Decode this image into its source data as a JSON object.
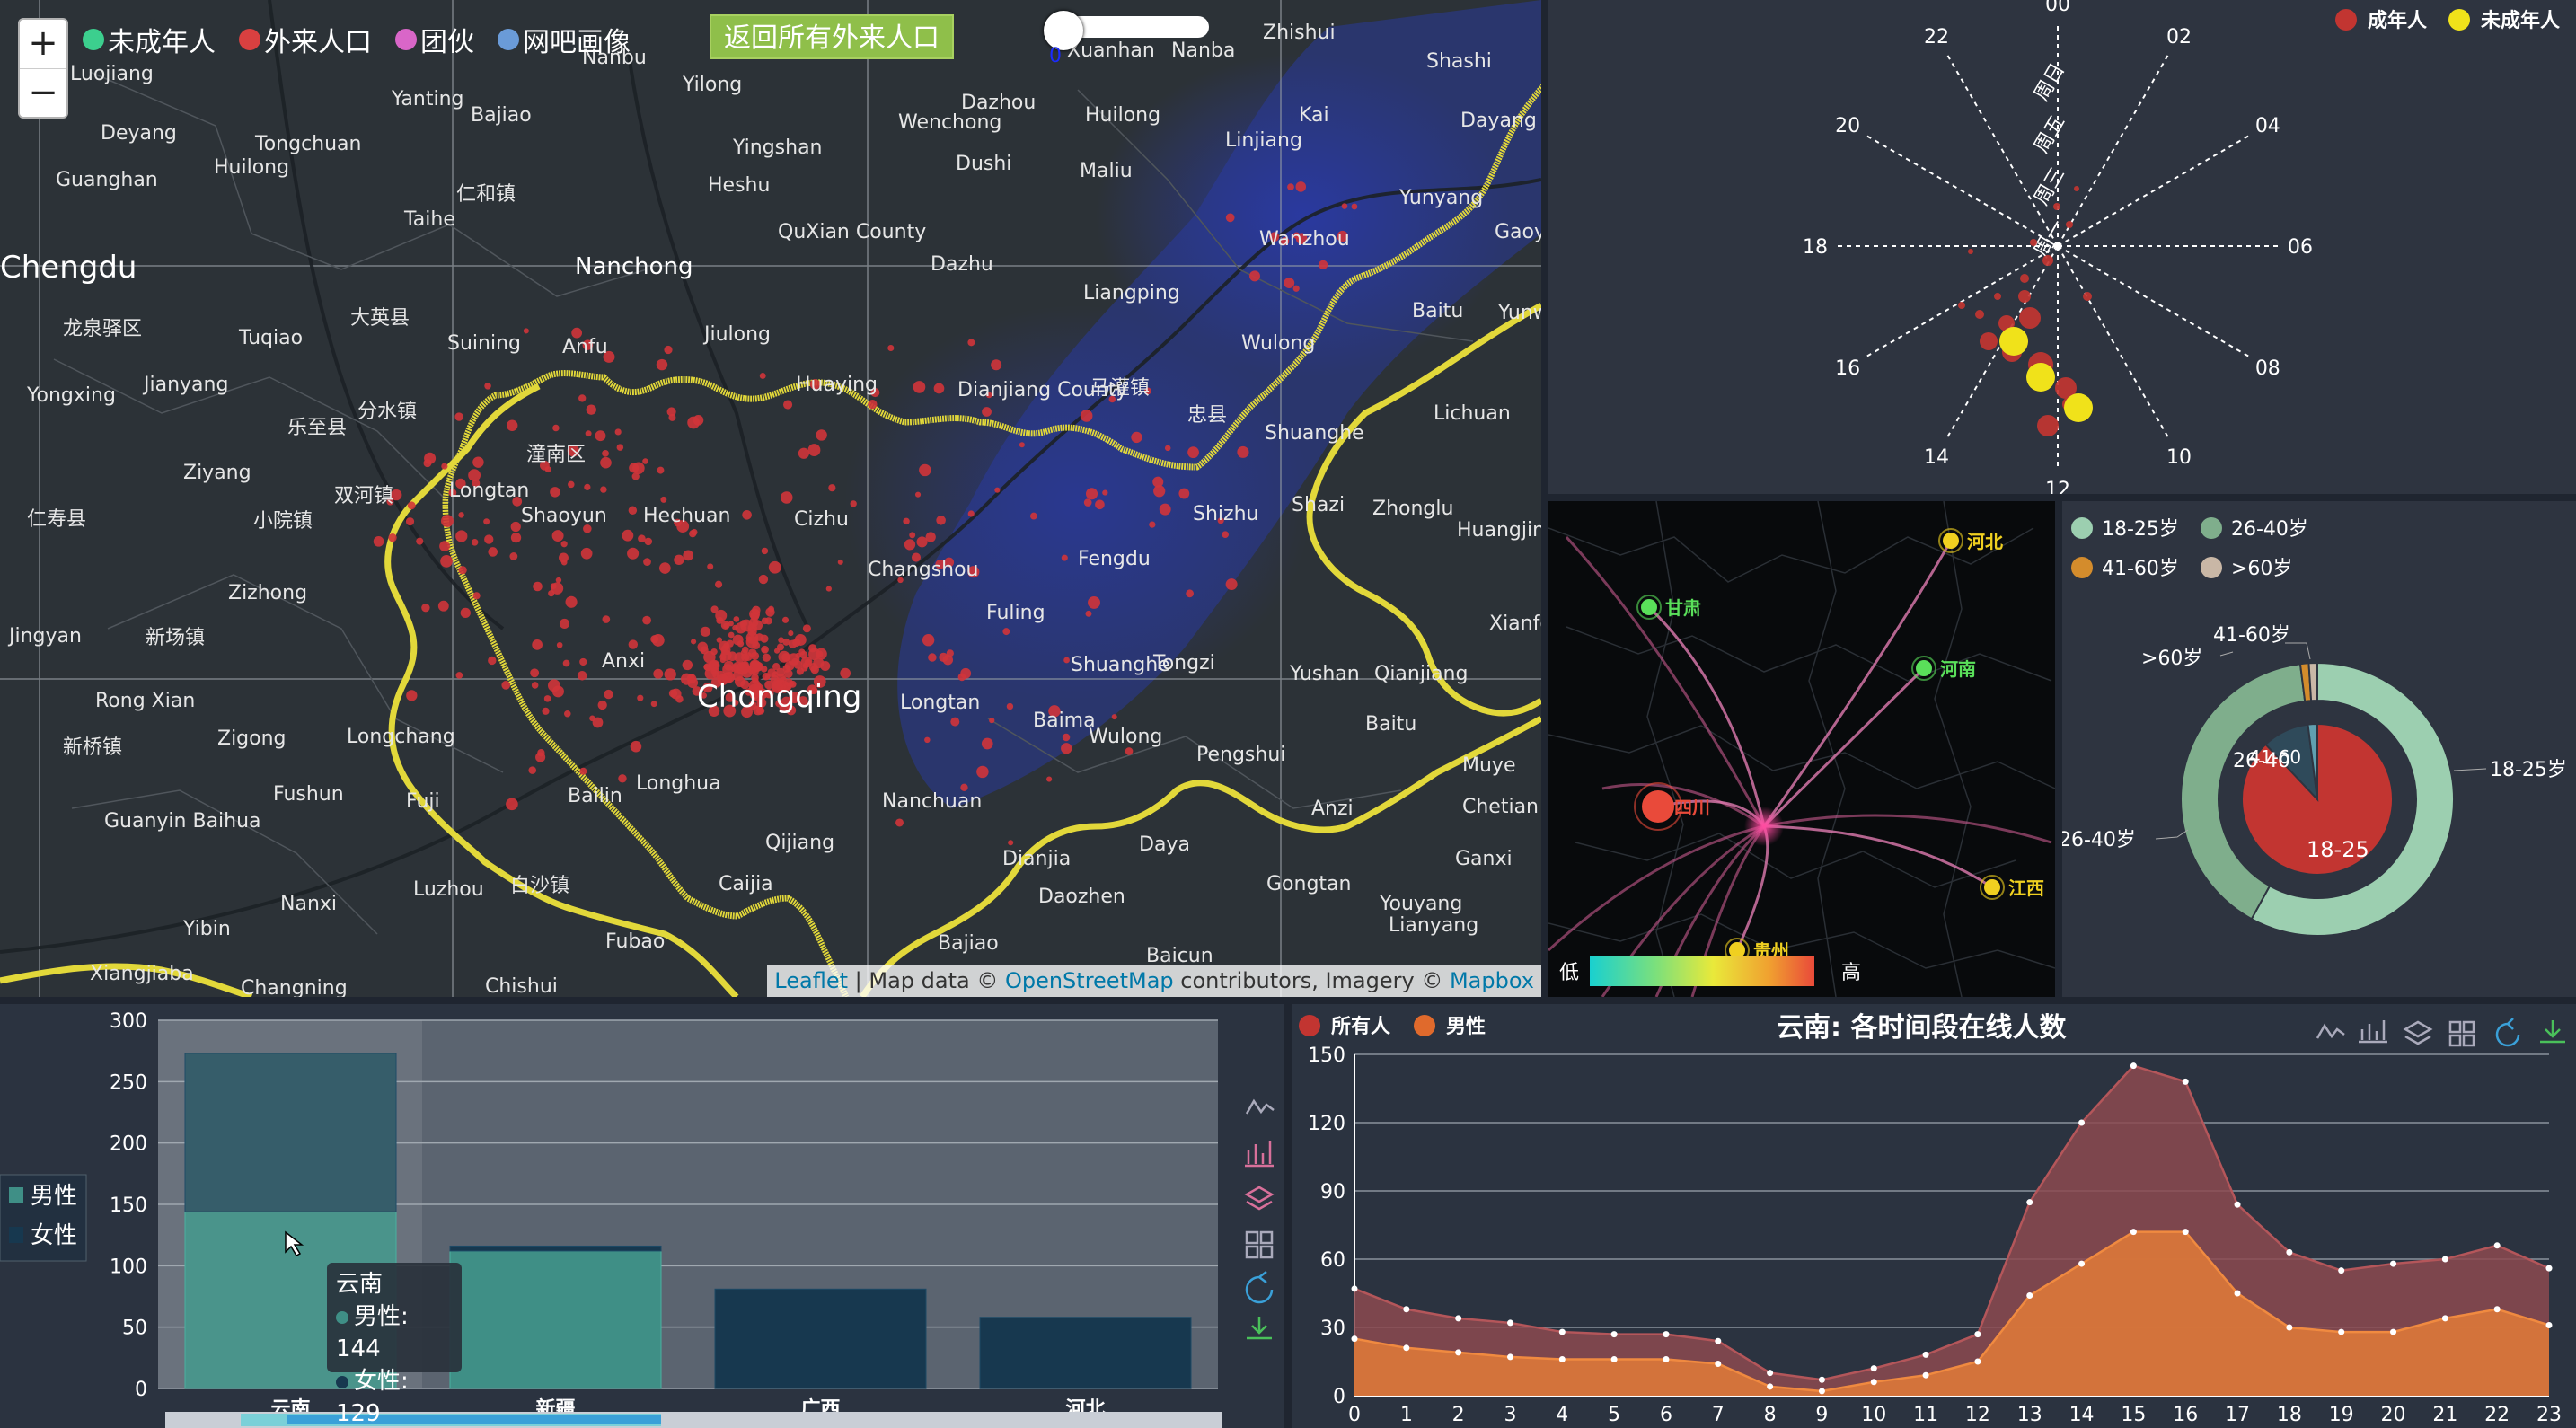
{
  "map": {
    "zoom_in": "+",
    "zoom_out": "−",
    "layers": [
      {
        "label": "未成年人",
        "color": "#3ccf8e"
      },
      {
        "label": "外来人口",
        "color": "#d94040"
      },
      {
        "label": "团伙",
        "color": "#d966c8"
      },
      {
        "label": "网吧画像",
        "color": "#6a9bd8"
      }
    ],
    "back_button": "返回所有外来人口",
    "slider_value": "0",
    "attribution": {
      "leaflet": "Leaflet",
      "sep1": " | Map data © ",
      "osm": "OpenStreetMap",
      "sep2": " contributors, Imagery © ",
      "mapbox": "Mapbox"
    },
    "place_labels": [
      {
        "text": "Luojiang"
      },
      {
        "text": "Nanbu"
      },
      {
        "text": "Yilong"
      },
      {
        "text": "Dazhou"
      },
      {
        "text": "Xuanhan"
      },
      {
        "text": "Deyang"
      },
      {
        "text": "Tongchuan"
      },
      {
        "text": "Yingshan"
      },
      {
        "text": "Wenchong"
      },
      {
        "text": "Huilong"
      },
      {
        "text": "Guanghan"
      },
      {
        "text": "Huilong"
      },
      {
        "text": "Heshu"
      },
      {
        "text": "Dushi"
      },
      {
        "text": "Maliu"
      },
      {
        "text": "Kai"
      },
      {
        "text": "Linjiang"
      },
      {
        "text": "Shashi"
      },
      {
        "text": "Dayang"
      },
      {
        "text": "Yunyang"
      },
      {
        "text": "Chengdu"
      },
      {
        "text": "Nanchong"
      },
      {
        "text": "QuXian County"
      },
      {
        "text": "Dazhu"
      },
      {
        "text": "Liangping"
      },
      {
        "text": "Wanzhou"
      },
      {
        "text": "大英县"
      },
      {
        "text": "Suining"
      },
      {
        "text": "Anfu"
      },
      {
        "text": "Jiulong"
      },
      {
        "text": "Huaying"
      },
      {
        "text": "Dianjiang County"
      },
      {
        "text": "马灌镇"
      },
      {
        "text": "忠县"
      },
      {
        "text": "Wulong"
      },
      {
        "text": "Baitu"
      },
      {
        "text": "Lichuan"
      },
      {
        "text": "龙泉驿区"
      },
      {
        "text": "Tuqiao"
      },
      {
        "text": "Jianyang"
      },
      {
        "text": "乐至县"
      },
      {
        "text": "分水镇"
      },
      {
        "text": "潼南区"
      },
      {
        "text": "Shuanghe"
      },
      {
        "text": "Ziyang"
      },
      {
        "text": "双河镇"
      },
      {
        "text": "Longtan"
      },
      {
        "text": "Shaoyun"
      },
      {
        "text": "Hechuan"
      },
      {
        "text": "Cizhu"
      },
      {
        "text": "Changshou"
      },
      {
        "text": "Fengdu"
      },
      {
        "text": "Shizhu"
      },
      {
        "text": "Shazi"
      },
      {
        "text": "Zhonglu"
      },
      {
        "text": "Huangjindong"
      },
      {
        "text": "仁寿县"
      },
      {
        "text": "小院镇"
      },
      {
        "text": "Zizhong"
      },
      {
        "text": "Fuling"
      },
      {
        "text": "Jingyan"
      },
      {
        "text": "新场镇"
      },
      {
        "text": "Shuanghe"
      },
      {
        "text": "Tongzi"
      },
      {
        "text": "Chongqing"
      },
      {
        "text": "Yushan"
      },
      {
        "text": "Qianjiang"
      },
      {
        "text": "Xianfeng"
      },
      {
        "text": "Rong Xian"
      },
      {
        "text": "Zigong"
      },
      {
        "text": "Longchang"
      },
      {
        "text": "Anxi"
      },
      {
        "text": "Longtan"
      },
      {
        "text": "Baima"
      },
      {
        "text": "Wulong"
      },
      {
        "text": "Pengshui"
      },
      {
        "text": "Baitu"
      },
      {
        "text": "Muye"
      },
      {
        "text": "新桥镇"
      },
      {
        "text": "Fushun"
      },
      {
        "text": "Fuji"
      },
      {
        "text": "Bailin"
      },
      {
        "text": "Longhua"
      },
      {
        "text": "Nanchuan"
      },
      {
        "text": "Chetian"
      },
      {
        "text": "Anzi"
      },
      {
        "text": "Guanyin Baihua"
      },
      {
        "text": "Luzhou"
      },
      {
        "text": "Qijiang"
      },
      {
        "text": "Daya"
      },
      {
        "text": "Ganxi"
      },
      {
        "text": "Nanxi"
      },
      {
        "text": "白沙镇"
      },
      {
        "text": "Caijia"
      },
      {
        "text": "Dianjia"
      },
      {
        "text": "Daozhen"
      },
      {
        "text": "Gongtan"
      },
      {
        "text": "Youyang"
      },
      {
        "text": "Yibin"
      },
      {
        "text": "Fubao"
      },
      {
        "text": "Xiangjiaba"
      },
      {
        "text": "Changning"
      },
      {
        "text": "Chishui"
      },
      {
        "text": "Bajiao"
      },
      {
        "text": "Baicun"
      },
      {
        "text": "Yanting"
      },
      {
        "text": "Bajiao"
      },
      {
        "text": "仁和镇"
      },
      {
        "text": "Taihe"
      },
      {
        "text": "Yongxing"
      },
      {
        "text": "Zhishui"
      },
      {
        "text": "Nanba"
      },
      {
        "text": "Gaoy"
      },
      {
        "text": "Yunw"
      },
      {
        "text": "Lianyang"
      }
    ]
  },
  "radial": {
    "legend": [
      {
        "label": "成年人",
        "color": "#c23531"
      },
      {
        "label": "未成年人",
        "color": "#f0e21a"
      }
    ],
    "hours": [
      "00",
      "02",
      "04",
      "06",
      "08",
      "10",
      "12",
      "14",
      "16",
      "18",
      "20",
      "22"
    ],
    "days": [
      "周日",
      "周五",
      "周三",
      "周一"
    ]
  },
  "migration": {
    "provinces": [
      "河北",
      "甘肃",
      "河南",
      "四川",
      "江西",
      "贵州"
    ],
    "scale_low": "低",
    "scale_high": "高"
  },
  "donut": {
    "legend": [
      {
        "label": "18-25岁",
        "color": "#9ccfb0"
      },
      {
        "label": "26-40岁",
        "color": "#7fae8c"
      },
      {
        "label": "41-60岁",
        "color": "#d48c2c"
      },
      {
        "label": ">60岁",
        "color": "#c9b7a6"
      }
    ],
    "outer_labels": [
      ">60岁",
      "41-60岁",
      "18-25岁",
      "26-40岁"
    ],
    "inner_labels": [
      "18-25",
      "26-40",
      "41-60"
    ]
  },
  "bar": {
    "legend": [
      {
        "label": "男性",
        "color": "#3f8f86"
      },
      {
        "label": "女性",
        "color": "#17384f"
      }
    ],
    "tooltip": {
      "title": "云南",
      "male": "男性: 144",
      "female": "女性: 129"
    },
    "toolbox": [
      "line-chart-icon",
      "bar-chart-icon",
      "stack-icon",
      "tiled-icon",
      "restore-icon",
      "download-icon"
    ]
  },
  "line": {
    "title": "云南: 各时间段在线人数",
    "legend": [
      {
        "label": "所有人",
        "color": "#c23531"
      },
      {
        "label": "男性",
        "color": "#e06a2c"
      }
    ],
    "toolbox": [
      "line-chart-icon",
      "bar-chart-icon",
      "stack-icon",
      "tiled-icon",
      "restore-icon",
      "download-icon"
    ]
  },
  "chart_data": [
    {
      "type": "bar",
      "categories": [
        "云南",
        "新疆",
        "广西",
        "河北"
      ],
      "series": [
        {
          "name": "男性",
          "values": [
            144,
            112,
            0,
            0
          ]
        },
        {
          "name": "女性",
          "values": [
            129,
            4,
            81,
            58
          ]
        }
      ],
      "ylim": [
        0,
        300
      ],
      "yticks": [
        0,
        50,
        100,
        150,
        200,
        250,
        300
      ],
      "grid": true,
      "legend_position": "left"
    },
    {
      "type": "area",
      "title": "云南: 各时间段在线人数",
      "x": [
        0,
        1,
        2,
        3,
        4,
        5,
        6,
        7,
        8,
        9,
        10,
        11,
        12,
        13,
        14,
        15,
        16,
        17,
        18,
        19,
        20,
        21,
        22,
        23
      ],
      "series": [
        {
          "name": "所有人",
          "values": [
            47,
            38,
            34,
            32,
            28,
            27,
            27,
            24,
            10,
            7,
            12,
            18,
            27,
            85,
            120,
            145,
            138,
            84,
            63,
            55,
            58,
            60,
            66,
            56
          ]
        },
        {
          "name": "男性",
          "values": [
            25,
            21,
            19,
            17,
            16,
            16,
            16,
            14,
            4,
            2,
            6,
            9,
            15,
            44,
            58,
            72,
            72,
            45,
            30,
            28,
            28,
            34,
            38,
            31
          ]
        }
      ],
      "ylim": [
        0,
        150
      ],
      "yticks": [
        0,
        30,
        60,
        90,
        120,
        150
      ],
      "grid": true,
      "legend_position": "top-left"
    },
    {
      "type": "pie",
      "outer": [
        {
          "name": "18-25岁",
          "value": 58
        },
        {
          "name": "26-40岁",
          "value": 40
        },
        {
          "name": "41-60岁",
          "value": 1
        },
        {
          "name": ">60岁",
          "value": 1
        }
      ],
      "inner": [
        {
          "name": "18-25",
          "value": 88
        },
        {
          "name": "26-40",
          "value": 10
        },
        {
          "name": "41-60",
          "value": 2
        }
      ],
      "legend_position": "top-left"
    }
  ]
}
